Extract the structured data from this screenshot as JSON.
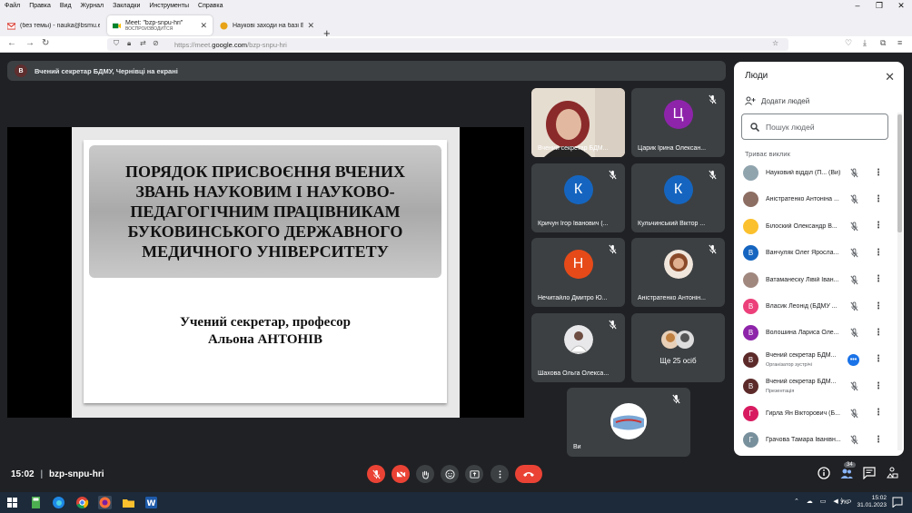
{
  "menu": [
    "Файл",
    "Правка",
    "Вид",
    "Журнал",
    "Закладки",
    "Инструменты",
    "Справка"
  ],
  "tabs": [
    {
      "title": "(без темы) - nauka@bsmu.edu",
      "fav_color": "#d93025",
      "active": false
    },
    {
      "title": "Meet: \"bzp-snpu-hri\"",
      "subtitle": "ВОСПРОИЗВОДИТСЯ",
      "fav_color": "#00832d",
      "active": true
    },
    {
      "title": "Наукові заходи на базі БДМУ",
      "fav_color": "#e8a317",
      "active": false
    }
  ],
  "url": {
    "prefix": "https://meet.",
    "host": "google.com",
    "path": "/bzp-snpu-hri"
  },
  "presenting": {
    "avatar": "В",
    "text": "Вчений секретар БДМУ, Чернівці на екрані"
  },
  "slide": {
    "title": "ПОРЯДОК ПРИСВОЄННЯ ВЧЕНИХ ЗВАНЬ НАУКОВИМ І НАУКОВО-ПЕДАГОГІЧНИМ ПРАЦІВНИКАМ БУКОВИНСЬКОГО ДЕРЖАВНОГО МЕДИЧНОГО УНІВЕРСИТЕТУ",
    "author_line1": "Учений секретар, професор",
    "author_line2": "Альона  АНТОНІВ"
  },
  "tiles": [
    {
      "name": "Вчений секретар БДМ...",
      "type": "photo"
    },
    {
      "name": "Царик Ірина Олексан...",
      "initial": "Ц",
      "color": "#8e24aa",
      "muted": true
    },
    {
      "name": "Кричун Ігор Іванович (...",
      "initial": "К",
      "color": "#1565c0",
      "muted": true
    },
    {
      "name": "Кульчинський Віктор ...",
      "initial": "К",
      "color": "#1565c0",
      "muted": true
    },
    {
      "name": "Нечитайло Дмитро Ю...",
      "initial": "Н",
      "color": "#e64a19",
      "muted": true
    },
    {
      "name": "Аністратенко Антонін...",
      "type": "photo",
      "muted": true
    },
    {
      "name": "Шахова Ольга Олекса...",
      "type": "photo",
      "muted": true
    },
    {
      "name": "Ще 25 осіб",
      "type": "more"
    },
    {
      "name": "Ви",
      "type": "photo",
      "muted": true
    }
  ],
  "bottom": {
    "time": "15:02",
    "separator": "|",
    "meeting_code": "bzp-snpu-hri",
    "people_count": "34"
  },
  "people_panel": {
    "title": "Люди",
    "add_label": "Додати людей",
    "search_placeholder": "Пошук людей",
    "section": "Триває виклик",
    "participants": [
      {
        "name": "Науковий відділ (П... (Ви)",
        "initial": "",
        "color": "#90a4ae"
      },
      {
        "name": "Аністратенко Антоніна ...",
        "initial": "",
        "color": "#8d6e63"
      },
      {
        "name": "Білоский Олександр В...",
        "initial": "",
        "color": "#fbc02d"
      },
      {
        "name": "Ванчуляк Олег Яросла...",
        "initial": "В",
        "color": "#1565c0"
      },
      {
        "name": "Ватаманеску Лівій Іван...",
        "initial": "",
        "color": "#a1887f"
      },
      {
        "name": "Власик Леонід (БДМУ ...",
        "initial": "В",
        "color": "#ec407a"
      },
      {
        "name": "Волошина Лариса Оле...",
        "initial": "В",
        "color": "#8e24aa"
      },
      {
        "name": "Вчений секретар БДМ...",
        "role": "Організатор зустрічі",
        "initial": "В",
        "color": "#5d2a2a",
        "more_active": true
      },
      {
        "name": "Вчений секретар БДМ...",
        "role": "Презентація",
        "initial": "В",
        "color": "#5d2a2a"
      },
      {
        "name": "Гирла Ян Вікторович (Б...",
        "initial": "Г",
        "color": "#d81b60"
      },
      {
        "name": "Грачова Тамара Іванівн...",
        "initial": "Г",
        "color": "#78909c"
      }
    ]
  },
  "taskbar": {
    "time": "15:02",
    "date": "31.01.2023",
    "lang": "УКР"
  }
}
